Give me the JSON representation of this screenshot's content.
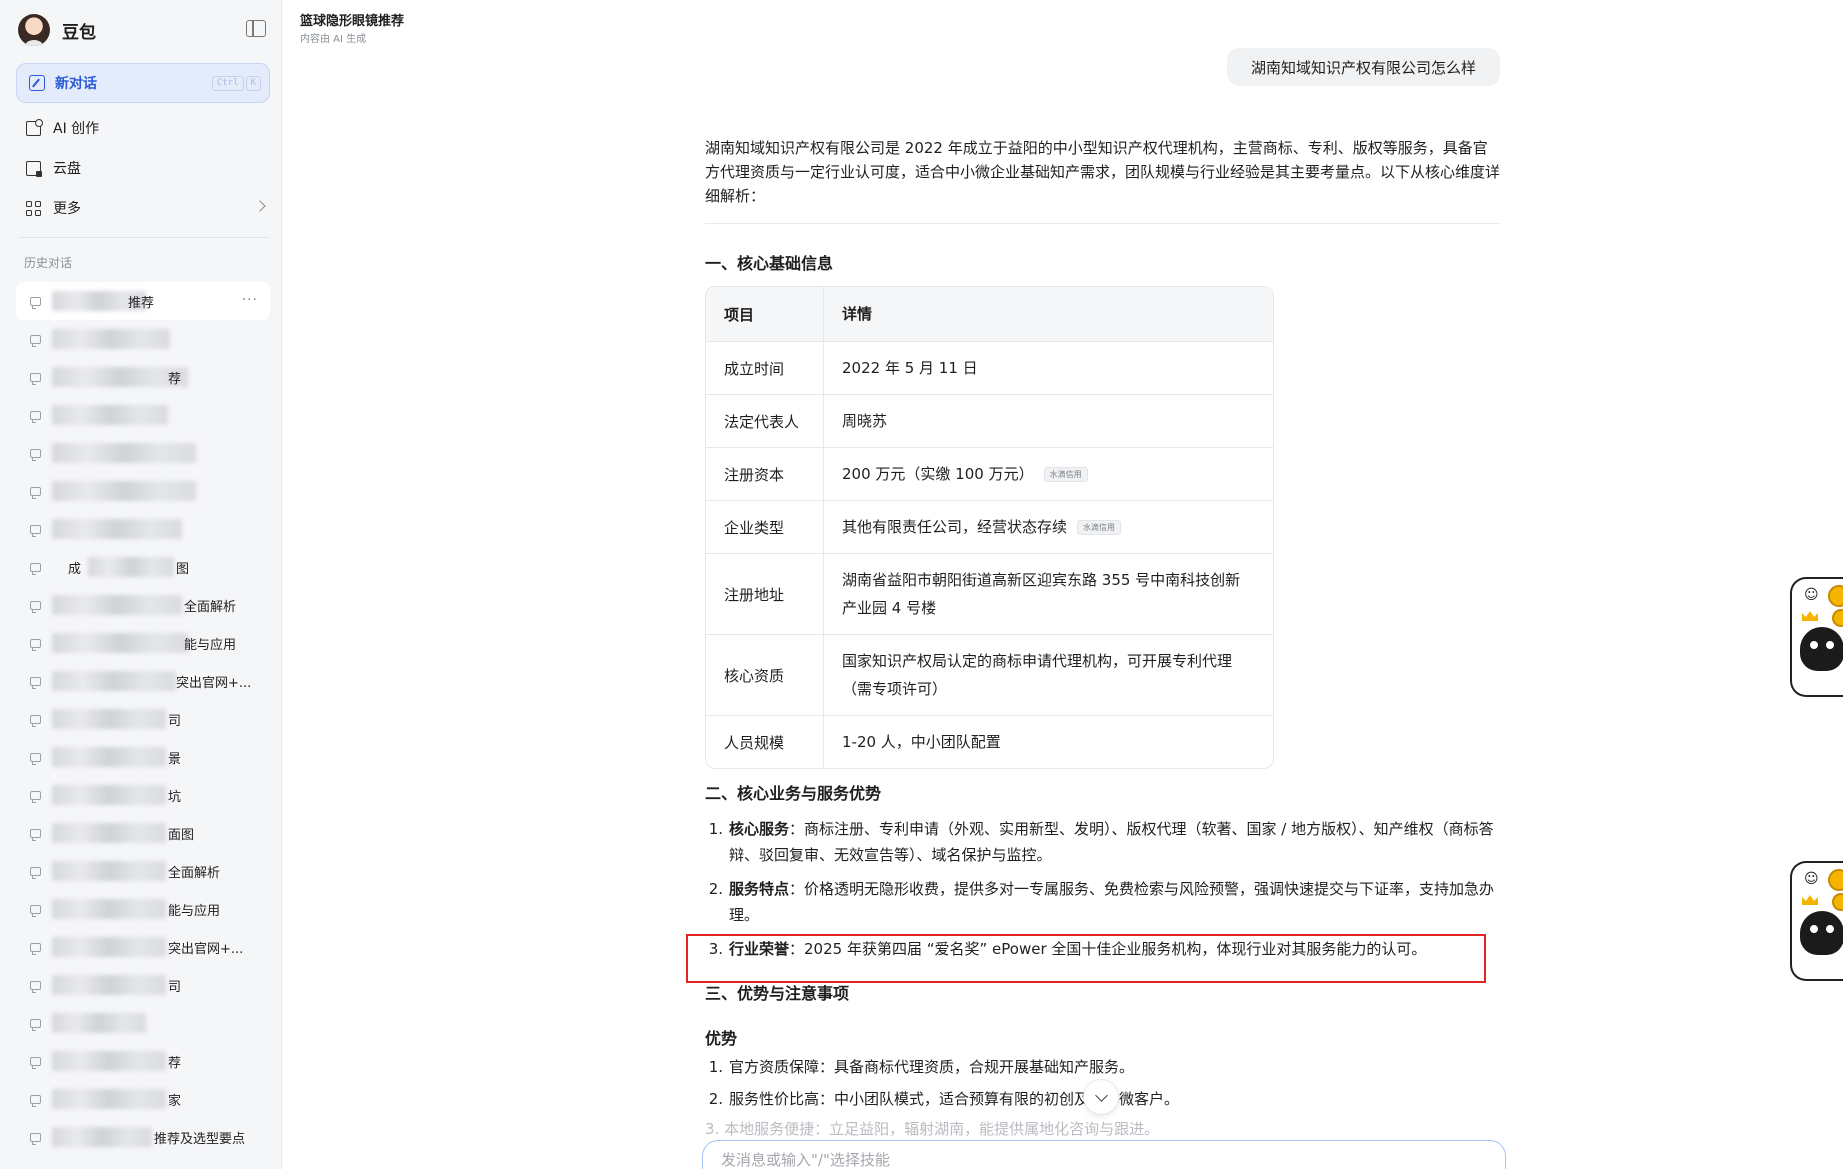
{
  "sidebar": {
    "brand": "豆包",
    "new_chat": {
      "label": "新对话",
      "shortcut": [
        "Ctrl",
        "K"
      ]
    },
    "nav": [
      {
        "label": "AI 创作",
        "icon": "ai-create-icon"
      },
      {
        "label": "云盘",
        "icon": "cloud-drive-icon"
      },
      {
        "label": "更多",
        "icon": "more-apps-icon"
      }
    ],
    "history_title": "历史对话",
    "history": [
      {
        "visible_text": "推荐",
        "active": true
      },
      {
        "visible_text": ""
      },
      {
        "visible_text": "荐"
      },
      {
        "visible_text": ""
      },
      {
        "visible_text": ""
      },
      {
        "visible_text": ""
      },
      {
        "visible_text": ""
      },
      {
        "visible_text": "成",
        "visible_text2": "图"
      },
      {
        "visible_text": "全面解析"
      },
      {
        "visible_text": "能与应用"
      },
      {
        "visible_text": "突出官网+..."
      },
      {
        "visible_text": "司"
      },
      {
        "visible_text": "景"
      },
      {
        "visible_text": "坑"
      },
      {
        "visible_text": "面图"
      },
      {
        "visible_text": "全面解析"
      },
      {
        "visible_text": "能与应用"
      },
      {
        "visible_text": "突出官网+..."
      },
      {
        "visible_text": "司"
      },
      {
        "visible_text": ""
      },
      {
        "visible_text": "荐"
      },
      {
        "visible_text": "家"
      },
      {
        "visible_text": "推荐及选型要点"
      }
    ]
  },
  "header": {
    "title": "篮球隐形眼镜推荐",
    "subtitle": "内容由 AI 生成"
  },
  "conversation": {
    "user_message": "湖南知域知识产权有限公司怎么样",
    "intro": "湖南知域知识产权有限公司是 2022 年成立于益阳的中小型知识产权代理机构，主营商标、专利、版权等服务，具备官方代理资质与一定行业认可度，适合中小微企业基础知产需求，团队规模与行业经验是其主要考量点。以下从核心维度详细解析：",
    "section1_title": "一、核心基础信息",
    "table": {
      "headers": [
        "项目",
        "详情"
      ],
      "rows": [
        {
          "k": "成立时间",
          "v": "2022 年 5 月 11 日",
          "tag": ""
        },
        {
          "k": "法定代表人",
          "v": "周晓苏",
          "tag": ""
        },
        {
          "k": "注册资本",
          "v": "200 万元（实缴 100 万元）",
          "tag": "水滴信用"
        },
        {
          "k": "企业类型",
          "v": "其他有限责任公司，经营状态存续",
          "tag": "水滴信用"
        },
        {
          "k": "注册地址",
          "v": "湖南省益阳市朝阳街道高新区迎宾东路 355 号中南科技创新产业园 4 号楼",
          "tag": ""
        },
        {
          "k": "核心资质",
          "v": "国家知识产权局认定的商标申请代理机构，可开展专利代理（需专项许可）",
          "tag": ""
        },
        {
          "k": "人员规模",
          "v": "1-20 人，中小团队配置",
          "tag": ""
        }
      ]
    },
    "section2_title": "二、核心业务与服务优势",
    "section2_items": [
      {
        "num": "1.",
        "bold": "核心服务",
        "text": "：商标注册、专利申请（外观、实用新型、发明）、版权代理（软著、国家 / 地方版权）、知产维权（商标答辩、驳回复审、无效宣告等）、域名保护与监控。"
      },
      {
        "num": "2.",
        "bold": "服务特点",
        "text": "：价格透明无隐形收费，提供多对一专属服务、免费检索与风险预警，强调快速提交与下证率，支持加急办理。"
      },
      {
        "num": "3.",
        "bold": "行业荣誉",
        "text": "：2025 年获第四届 “爱名奖” ePower 全国十佳企业服务机构，体现行业对其服务能力的认可。"
      }
    ],
    "section3_title": "三、优势与注意事项",
    "advantages_title": "优势",
    "advantages": [
      {
        "num": "1.",
        "text": "官方资质保障：具备商标代理资质，合规开展基础知产服务。"
      },
      {
        "num": "2.",
        "text": "服务性价比高：中小团队模式，适合预算有限的初创及中小微客户。"
      }
    ],
    "faded_line": "3. 本地服务便捷：立足益阳，辐射湖南，能提供属地化咨询与跟进。"
  },
  "input": {
    "placeholder": "发消息或输入\"/\"选择技能"
  }
}
